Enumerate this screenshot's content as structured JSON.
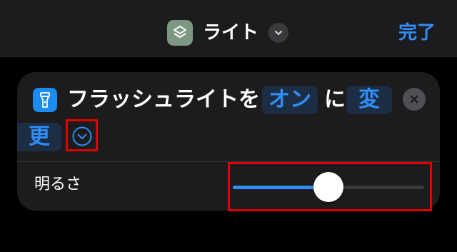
{
  "header": {
    "title": "ライト",
    "app_icon": "layers-icon",
    "menu_icon": "chevron-down-icon",
    "done_label": "完了"
  },
  "action": {
    "icon": "flashlight-icon",
    "prefix": "フラッシュライトを",
    "state_token": "オン",
    "particle": "に",
    "verb_part1": "変",
    "verb_part2": "更",
    "clear_icon": "close-icon",
    "expand_icon": "chevron-down-circle-icon"
  },
  "brightness": {
    "label": "明るさ",
    "value": 0.5
  },
  "colors": {
    "accent": "#2f8ef7",
    "background": "#000000",
    "card": "#1c1c1e",
    "token_bg": "#1d2d44",
    "annotation": "#e00000"
  }
}
